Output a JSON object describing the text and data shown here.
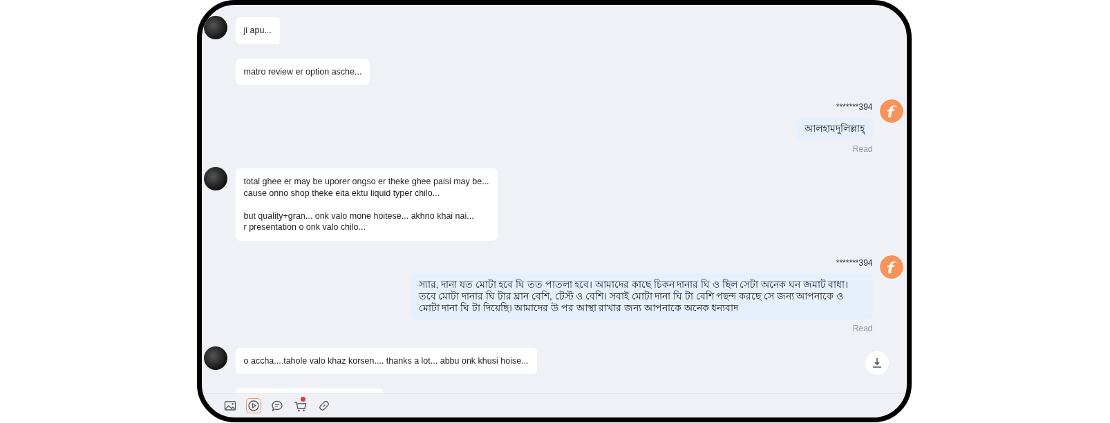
{
  "messages": [
    {
      "kind": "incoming",
      "avatar": true,
      "text": "ji apu..."
    },
    {
      "kind": "incoming",
      "avatar": false,
      "text": "matro review er option asche..."
    },
    {
      "kind": "outgoing",
      "avatar": true,
      "sender": "*******394",
      "text": "আলহামদুলিল্লাহ্",
      "status": "Read"
    },
    {
      "kind": "incoming",
      "avatar": true,
      "text": "total ghee er may be uporer ongso er theke ghee paisi may be...\ncause onno shop theke eita ektu liquid typer chilo...\n\nbut quality+gran... onk valo mone hoitese... akhno khai nai...\nr presentation o onk valo chilo..."
    },
    {
      "kind": "outgoing",
      "avatar": true,
      "sender": "*******394",
      "text": "স্যার, দানা যত মোটা হবে ঘি তত পাতলা হবে। আমাদের কাছে চিকন দানার ঘি ও ছিল সেটা অনেক ঘন জমাট বাধা। তবে মোটা দানার ঘি টার ঘ্রান বেশি, টেস্ট ও বেশি। সবাই মোটা দানা ঘি টা বেশি পছন্দ করছে সে জন্য আপনাকে ও মোটা দানা ঘি টা দিয়েছি। আমাদের উ পর আস্থা রাখার জন্য আপনাকে অনেক ধন্যবাদ",
      "status": "Read"
    },
    {
      "kind": "incoming",
      "avatar": true,
      "text": "o accha....tahole valo khaz korsen.... thanks a lot... abbu onk khusi hoise..."
    },
    {
      "kind": "incoming",
      "avatar": false
    }
  ],
  "toolbar": [
    {
      "kind": "image",
      "selected": false,
      "dot": false
    },
    {
      "kind": "video",
      "selected": true,
      "dot": false
    },
    {
      "kind": "chat",
      "selected": false,
      "dot": false
    },
    {
      "kind": "cart",
      "selected": false,
      "dot": true
    },
    {
      "kind": "link",
      "selected": false,
      "dot": false
    }
  ]
}
